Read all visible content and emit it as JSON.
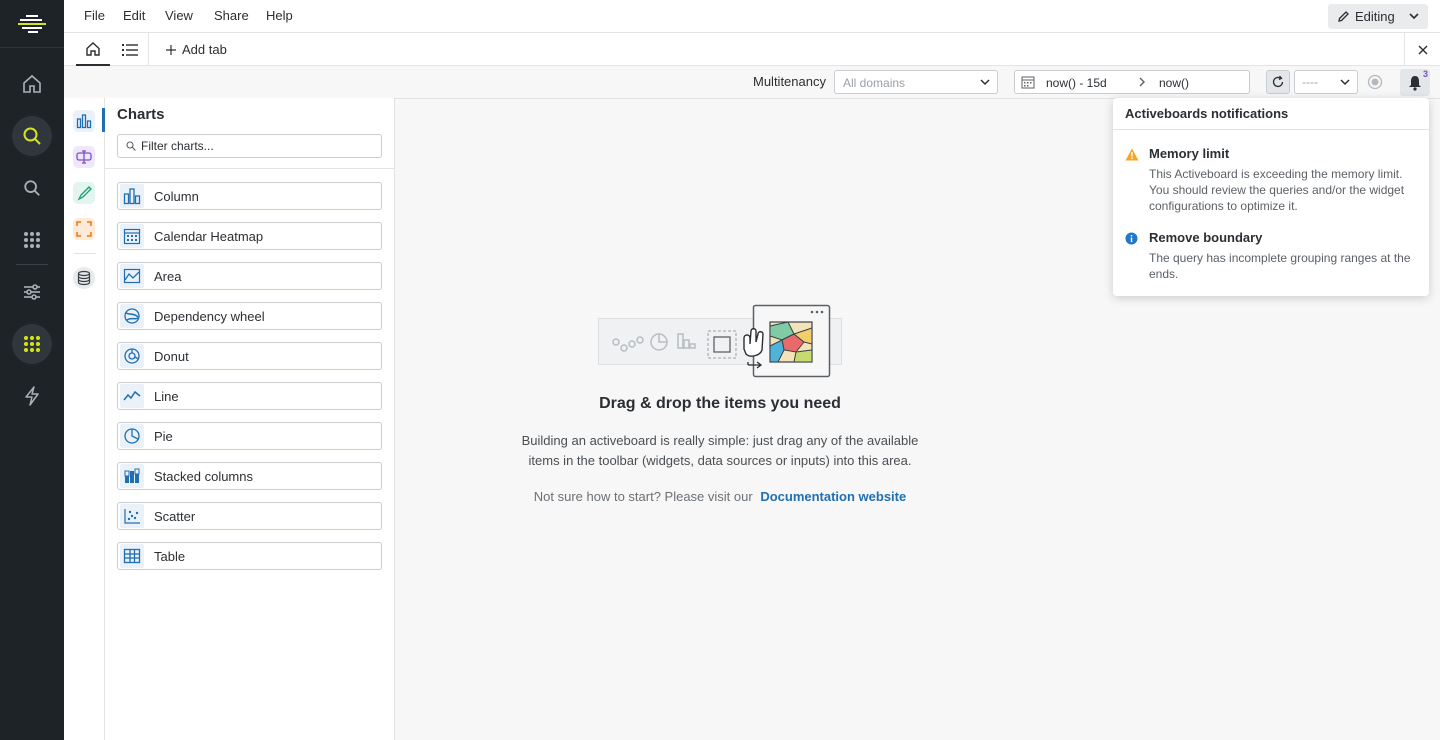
{
  "menu": {
    "file": "File",
    "edit": "Edit",
    "view": "View",
    "share": "Share",
    "help": "Help",
    "editing_label": "Editing"
  },
  "tabs": {
    "add_tab_label": "Add tab"
  },
  "toolbar": {
    "multitenancy_label": "Multitenancy",
    "domains_placeholder": "All domains",
    "date_from": "now() - 15d",
    "date_to": "now()",
    "interval_value": "----",
    "notification_count": "3"
  },
  "charts_panel": {
    "title": "Charts",
    "filter_placeholder": "Filter charts...",
    "items": [
      {
        "label": "Column",
        "icon": "column-chart-icon"
      },
      {
        "label": "Calendar Heatmap",
        "icon": "calendar-heatmap-icon"
      },
      {
        "label": "Area",
        "icon": "area-chart-icon"
      },
      {
        "label": "Dependency wheel",
        "icon": "dependency-wheel-icon"
      },
      {
        "label": "Donut",
        "icon": "donut-chart-icon"
      },
      {
        "label": "Line",
        "icon": "line-chart-icon"
      },
      {
        "label": "Pie",
        "icon": "pie-chart-icon"
      },
      {
        "label": "Stacked columns",
        "icon": "stacked-columns-icon"
      },
      {
        "label": "Scatter",
        "icon": "scatter-chart-icon"
      },
      {
        "label": "Table",
        "icon": "table-icon"
      }
    ]
  },
  "canvas": {
    "title": "Drag & drop the items you need",
    "description": "Building an activeboard is really simple: just drag any of the available items in the toolbar (widgets, data sources or inputs) into this area.",
    "doc_prompt": "Not sure how to start? Please visit our",
    "doc_link": "Documentation website"
  },
  "notifications": {
    "title": "Activeboards notifications",
    "entries": [
      {
        "title": "Memory limit",
        "text": "This Activeboard is exceeding the memory limit. You should review the queries and/or the widget configurations to optimize it.",
        "level": "warning"
      },
      {
        "title": "Remove boundary",
        "text": "The query has incomplete grouping ranges at the ends.",
        "level": "info"
      }
    ]
  },
  "colors": {
    "nav_bg": "#1e2327",
    "accent_yellow": "#d5e419",
    "link_blue": "#1f6fb2",
    "warning": "#f5a623",
    "info": "#1f78c8"
  }
}
